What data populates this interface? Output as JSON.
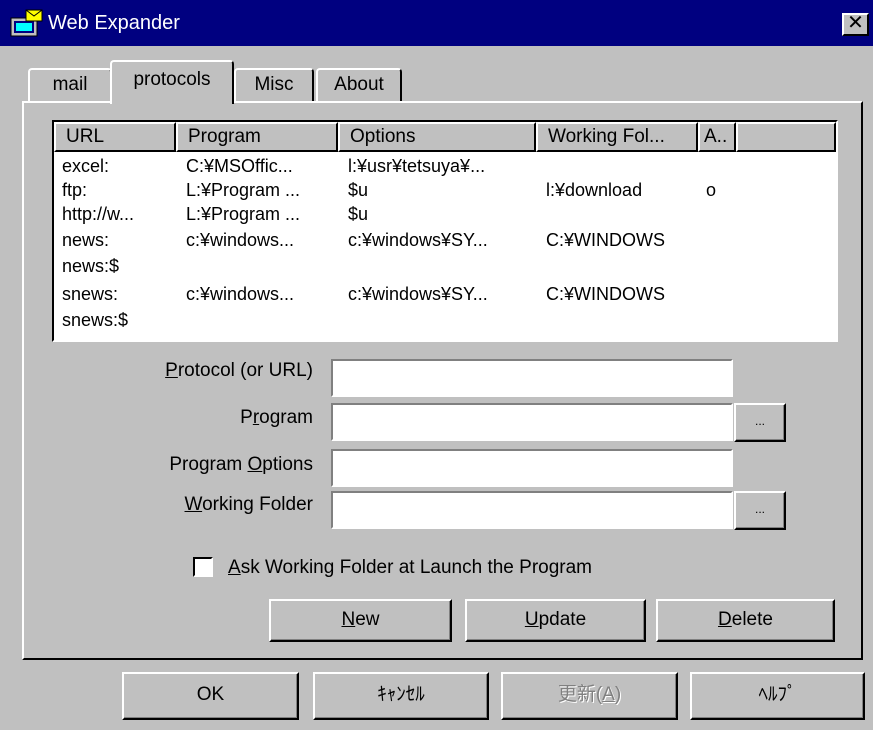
{
  "window": {
    "title": "Web Expander",
    "close_glyph": "✕",
    "icon": "app-icon"
  },
  "tabs": [
    {
      "label": "mail"
    },
    {
      "label": "protocols",
      "active": true
    },
    {
      "label": "Misc"
    },
    {
      "label": "About"
    }
  ],
  "list": {
    "columns": [
      "URL",
      "Program",
      "Options",
      "Working Fol...",
      "A.."
    ],
    "rows": [
      [
        "excel:",
        "C:¥MSOffic...",
        "l:¥usr¥tetsuya¥...",
        "",
        ""
      ],
      [
        "ftp:",
        "L:¥Program ...",
        "$u",
        "l:¥download",
        "o"
      ],
      [
        "http://w...",
        "L:¥Program ...",
        "$u",
        "",
        ""
      ],
      [
        "news:",
        "c:¥windows...",
        "c:¥windows¥SY...",
        "C:¥WINDOWS",
        ""
      ],
      [
        "news:$",
        "",
        "",
        "",
        ""
      ],
      [
        "snews:",
        "c:¥windows...",
        "c:¥windows¥SY...",
        "C:¥WINDOWS",
        ""
      ],
      [
        "snews:$",
        "",
        "",
        "",
        ""
      ]
    ]
  },
  "form": {
    "protocol": {
      "label_mn": "P",
      "label_rest": "rotocol (or URL)",
      "value": ""
    },
    "program": {
      "label_pre": "P",
      "label_mn": "r",
      "label_rest": "ogram",
      "value": ""
    },
    "options": {
      "label_pre": "Program ",
      "label_mn": "O",
      "label_rest": "ptions",
      "value": ""
    },
    "folder": {
      "label_mn": "W",
      "label_rest": "orking Folder",
      "value": ""
    },
    "browse_label": "...",
    "ask_checkbox": {
      "label_mn": "A",
      "label_rest": "sk Working Folder at Launch the Program",
      "checked": false
    }
  },
  "actions": {
    "new": {
      "mn": "N",
      "rest": "ew"
    },
    "update": {
      "mn": "U",
      "rest": "pdate"
    },
    "delete": {
      "mn": "D",
      "rest": "elete"
    }
  },
  "footer": {
    "ok": "OK",
    "cancel": "ｷｬﾝｾﾙ",
    "apply_pre": "更新(",
    "apply_mn": "A",
    "apply_post": ")",
    "help": "ﾍﾙﾌﾟ"
  }
}
